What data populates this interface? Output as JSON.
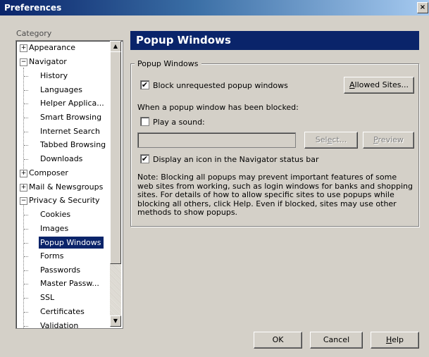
{
  "window": {
    "title": "Preferences",
    "close_glyph": "×"
  },
  "sidebar": {
    "label": "Category",
    "items": [
      {
        "label": "Appearance",
        "expander": "+"
      },
      {
        "label": "Navigator",
        "expander": "−"
      },
      {
        "label": "History"
      },
      {
        "label": "Languages"
      },
      {
        "label": "Helper Applica..."
      },
      {
        "label": "Smart Browsing"
      },
      {
        "label": "Internet Search"
      },
      {
        "label": "Tabbed Browsing"
      },
      {
        "label": "Downloads"
      },
      {
        "label": "Composer",
        "expander": "+"
      },
      {
        "label": "Mail & Newsgroups",
        "expander": "+"
      },
      {
        "label": "Privacy & Security",
        "expander": "−"
      },
      {
        "label": "Cookies"
      },
      {
        "label": "Images"
      },
      {
        "label": "Popup Windows",
        "selected": true
      },
      {
        "label": "Forms"
      },
      {
        "label": "Passwords"
      },
      {
        "label": "Master Passw..."
      },
      {
        "label": "SSL"
      },
      {
        "label": "Certificates"
      },
      {
        "label": "Validation"
      }
    ]
  },
  "panel": {
    "title": "Popup Windows",
    "group_title": "Popup Windows",
    "block_checkbox": {
      "label": "Block unrequested popup windows",
      "checked": true
    },
    "allowed_sites_button": {
      "pre": "",
      "key": "A",
      "post": "llowed Sites..."
    },
    "blocked_heading": "When a popup window has been blocked:",
    "play_sound_checkbox": {
      "label": "Play a sound:",
      "checked": false
    },
    "sound_path": "",
    "select_button": {
      "pre": "Sel",
      "key": "e",
      "post": "ct..."
    },
    "preview_button": {
      "pre": "",
      "key": "P",
      "post": "review"
    },
    "display_icon_checkbox": {
      "label": "Display an icon in the Navigator status bar",
      "checked": true
    },
    "note": "Note: Blocking all popups may prevent important features of some web sites from working, such as login windows for banks and shopping sites. For details of how to allow specific sites to use popups while blocking all others, click Help. Even if blocked, sites may use other methods to show popups."
  },
  "footer": {
    "ok": "OK",
    "cancel": "Cancel",
    "help": {
      "pre": "",
      "key": "H",
      "post": "elp"
    }
  },
  "check_glyph": "✔",
  "colors": {
    "selection": "#0a246a",
    "dialog_bg": "#d4d0c8"
  }
}
